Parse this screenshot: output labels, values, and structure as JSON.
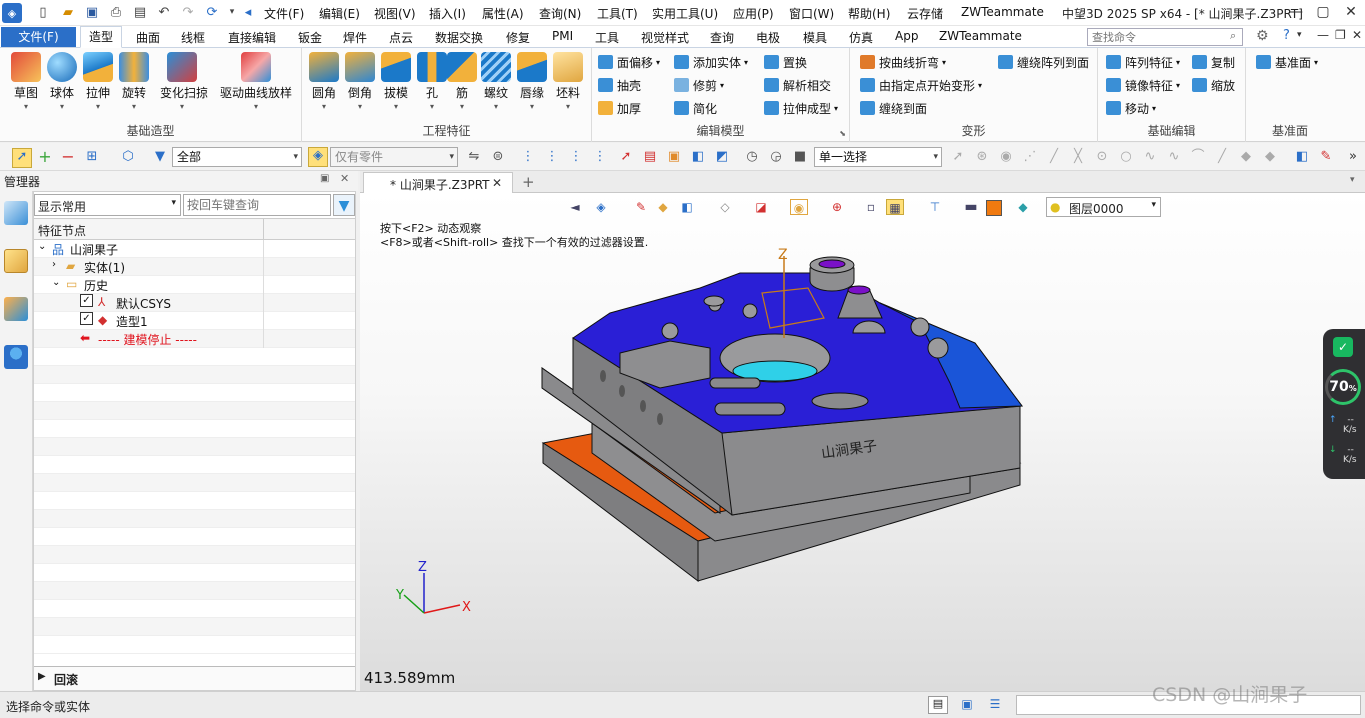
{
  "titlebar": {
    "menus": [
      "文件(F)",
      "编辑(E)",
      "视图(V)",
      "插入(I)",
      "属性(A)",
      "查询(N)",
      "工具(T)",
      "实用工具(U)",
      "应用(P)",
      "窗口(W)",
      "帮助(H)",
      "云存储",
      "ZWTeammate"
    ],
    "window_title": "中望3D 2025 SP x64 - [* 山涧果子.Z3PRT]"
  },
  "ribbon_tabs": {
    "file": "文件(F)",
    "tabs": [
      "造型",
      "曲面",
      "线框",
      "直接编辑",
      "钣金",
      "焊件",
      "点云",
      "数据交换",
      "修复",
      "PMI",
      "工具",
      "视觉样式",
      "查询",
      "电极",
      "模具",
      "仿真",
      "App",
      "ZWTeammate"
    ],
    "active": "造型",
    "search_placeholder": "查找命令"
  },
  "ribbon": {
    "groups": [
      {
        "label": "基础造型",
        "buttons": [
          "草图",
          "球体",
          "拉伸",
          "旋转",
          "变化扫掠",
          "驱动曲线放样"
        ]
      },
      {
        "label": "工程特征",
        "buttons": [
          "圆角",
          "倒角",
          "拔模",
          "孔",
          "筋",
          "螺纹",
          "唇缘",
          "坯料"
        ]
      },
      {
        "label": "编辑模型",
        "items": [
          "面偏移",
          "添加实体",
          "置换",
          "抽壳",
          "修剪",
          "解析相交",
          "加厚",
          "简化",
          "拉伸成型"
        ]
      },
      {
        "label": "变形",
        "items": [
          "按曲线折弯",
          "缠绕阵列到面",
          "由指定点开始变形",
          "缠绕到面"
        ]
      },
      {
        "label": "基础编辑",
        "items": [
          "阵列特征",
          "复制",
          "镜像特征",
          "缩放",
          "移动"
        ]
      },
      {
        "label": "基准面",
        "items": [
          "基准面"
        ]
      }
    ]
  },
  "toolbar2": {
    "filter_value": "全部",
    "scope_value": "仅有零件",
    "select_mode": "单一选择"
  },
  "manager": {
    "title": "管理器",
    "display_combo": "显示常用",
    "search_placeholder": "按回车键查询",
    "column_header": "特征节点",
    "tree": [
      {
        "label": "山涧果子"
      },
      {
        "label": "实体(1)"
      },
      {
        "label": "历史"
      },
      {
        "label": "默认CSYS"
      },
      {
        "label": "造型1"
      },
      {
        "label": "----- 建模停止 -----"
      }
    ],
    "footer": "回滚"
  },
  "document": {
    "tab_label": "* 山涧果子.Z3PRT",
    "hint_line1": "按下<F2> 动态观察",
    "hint_line2": "<F8>或者<Shift-roll> 查找下一个有效的过滤器设置.",
    "layer_combo": "图层0000",
    "scale_readout": "413.589mm",
    "engraving": "山涧果子",
    "axis_labels": {
      "x": "X",
      "y": "Y",
      "z": "Z"
    }
  },
  "perf_widget": {
    "percent": "70",
    "unit": "%",
    "up_rate": "--",
    "down_rate": "--",
    "rate_unit": "K/s"
  },
  "statusbar": {
    "prompt": "选择命令或实体",
    "watermark": "CSDN @山涧果子"
  },
  "colors": {
    "file_tab": "#2b6fc8",
    "top_face": "#2a1fd6",
    "body_gray": "#7e7e80",
    "orange_plate": "#e65a10",
    "green_face": "#2fc22f",
    "side_blue": "#1a55d8"
  }
}
